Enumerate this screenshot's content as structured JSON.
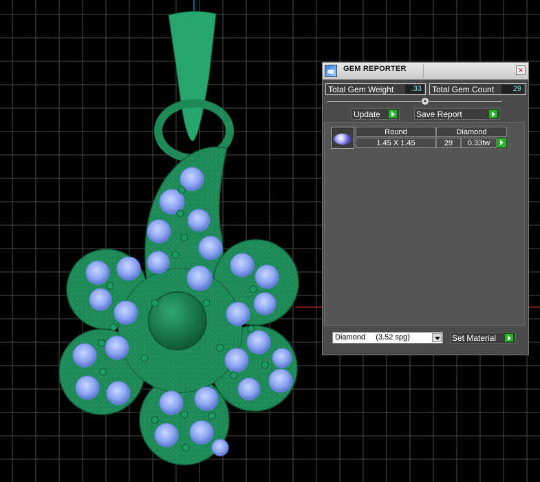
{
  "panel": {
    "title": "GEM REPORTER",
    "close_glyph": "×",
    "total_weight_label": "Total Gem Weight",
    "total_weight_value": ".33",
    "total_count_label": "Total Gem Count",
    "total_count_value": "29",
    "update_label": "Update",
    "save_report_label": "Save Report",
    "gems": [
      {
        "shape": "Round",
        "material": "Diamond",
        "size": "1.45 X 1.45",
        "count": "29",
        "weight": "0.33tw",
        "thumb_icon": "round-gem-icon"
      }
    ],
    "material_select": "Diamond     (3.52 spg)",
    "set_material_label": "Set Material"
  },
  "colors": {
    "model": "#1e8a57",
    "gem": "#8ea6f2",
    "grid": "#4d4d4d",
    "value_text": "#6ee0e8",
    "play_button": "#2bb12b"
  }
}
